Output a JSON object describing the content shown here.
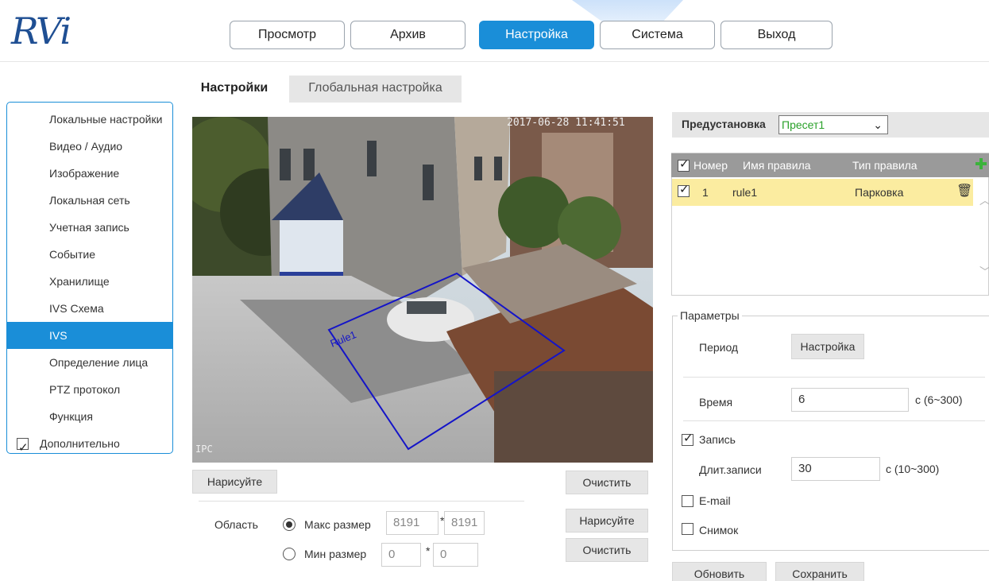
{
  "logo": "RVi",
  "nav": {
    "items": [
      {
        "label": "Просмотр",
        "active": false
      },
      {
        "label": "Архив",
        "active": false
      },
      {
        "label": "Настройка",
        "active": true
      },
      {
        "label": "Система",
        "active": false
      },
      {
        "label": "Выход",
        "active": false
      }
    ]
  },
  "tabs": {
    "active": "Настройки",
    "inactive": "Глобальная настройка"
  },
  "sidebar": {
    "items": [
      "Локальные настройки",
      "Видео / Аудио",
      "Изображение",
      "Локальная сеть",
      "Учетная запись",
      "Событие",
      "Хранилище",
      "IVS Схема",
      "IVS",
      "Определение лица",
      "PTZ протокол",
      "Функция"
    ],
    "active_item": "IVS",
    "advanced_label": "Дополнительно",
    "advanced_checked": true
  },
  "video": {
    "timestamp": "2017-06-28 11:41:51",
    "camera_name": "IPC",
    "rule_label": "Rule1"
  },
  "draw": {
    "draw_label": "Нарисуйте",
    "clear_label": "Очистить",
    "area_label": "Область",
    "max_size_label": "Макс размер",
    "max_w": "8191",
    "max_h": "8191",
    "min_size_label": "Мин размер",
    "min_w": "0",
    "min_h": "0",
    "separator": "*",
    "draw2_label": "Нарисуйте",
    "clear2_label": "Очистить",
    "size_mode": "max"
  },
  "preset": {
    "label": "Предустановка",
    "value": "Пресет1"
  },
  "rules": {
    "columns": [
      "Номер",
      "Имя правила",
      "Тип правила"
    ],
    "rows": [
      {
        "checked": true,
        "number": "1",
        "name": "rule1",
        "type": "Парковка"
      }
    ],
    "header_checked": true
  },
  "params": {
    "legend": "Параметры",
    "period_label": "Период",
    "period_button": "Настройка",
    "time_label": "Время",
    "time_value": "6",
    "time_unit": "c (6~300)",
    "record_label": "Запись",
    "record_checked": true,
    "record_dur_label": "Длит.записи",
    "record_dur_value": "30",
    "record_dur_unit": "c (10~300)",
    "email_label": "E-mail",
    "email_checked": false,
    "snapshot_label": "Снимок",
    "snapshot_checked": false
  },
  "footer": {
    "refresh_label": "Обновить",
    "save_label": "Сохранить"
  },
  "colors": {
    "accent": "#1a8ed8",
    "rule_polygon": "#1414c8",
    "selected_row": "#fbeca0",
    "preset_text": "#2aa12a"
  }
}
